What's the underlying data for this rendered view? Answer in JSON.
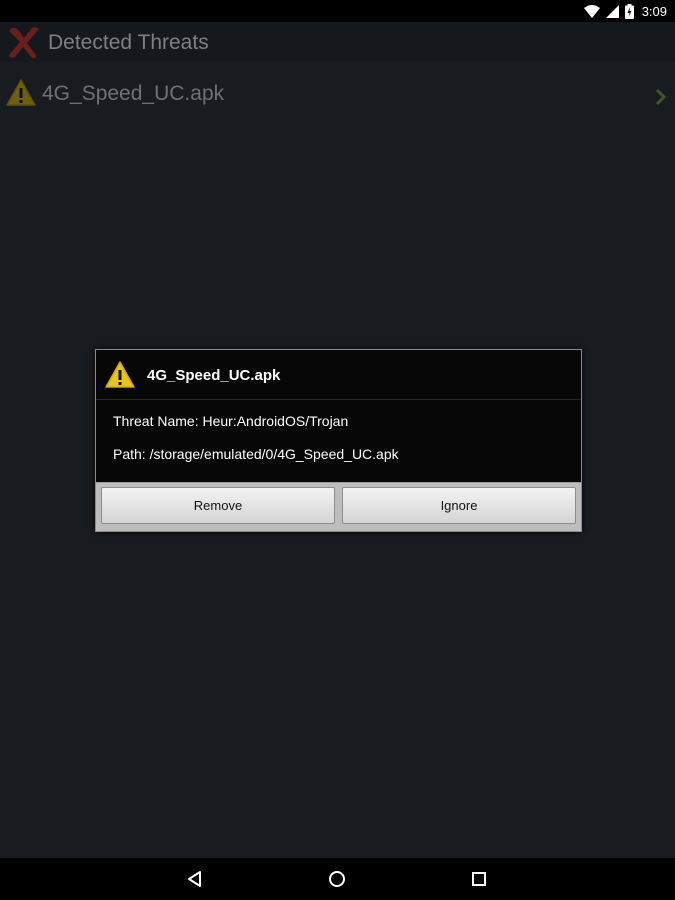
{
  "status_bar": {
    "time": "3:09",
    "icons": [
      "wifi-icon",
      "signal-icon",
      "battery-icon"
    ]
  },
  "app": {
    "title": "Detected Threats",
    "title_icon": "red-x-icon",
    "threats": [
      {
        "name": "4G_Speed_UC.apk",
        "icon": "warning-icon"
      }
    ]
  },
  "dialog": {
    "title": "4G_Speed_UC.apk",
    "icon": "warning-icon",
    "threat_name": "Threat Name: Heur:AndroidOS/Trojan",
    "path": "Path: /storage/emulated/0/4G_Speed_UC.apk",
    "remove_label": "Remove",
    "ignore_label": "Ignore"
  },
  "nav_bar": {
    "buttons": [
      "back-icon",
      "home-icon",
      "recents-icon"
    ]
  },
  "colors": {
    "background": "#181b20",
    "title_text": "#7c7f84",
    "warning_yellow": "#e8c31c",
    "chevron_green": "#4a6a26"
  }
}
